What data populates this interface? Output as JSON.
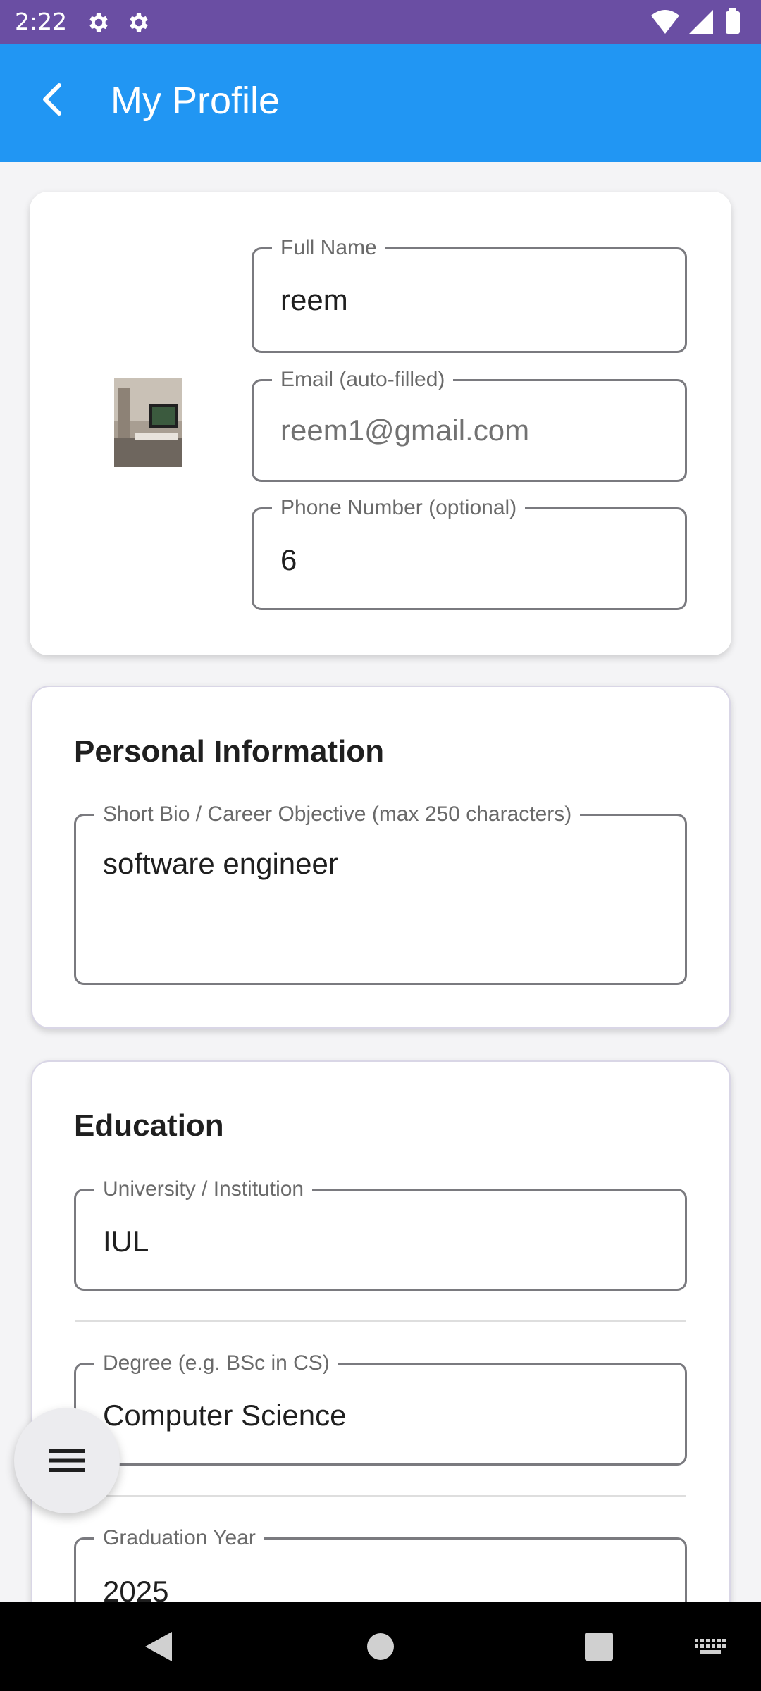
{
  "status_bar": {
    "time": "2:22",
    "icons": [
      "settings-icon",
      "settings-icon",
      "wifi-icon",
      "signal-icon",
      "battery-icon"
    ]
  },
  "app_bar": {
    "title": "My Profile",
    "back_icon": "chevron-left-icon"
  },
  "profile_card": {
    "avatar": "profile-photo",
    "full_name": {
      "label": "Full Name",
      "value": "reem"
    },
    "email": {
      "label": "Email (auto-filled)",
      "value": "reem1@gmail.com"
    },
    "phone": {
      "label": "Phone Number (optional)",
      "value": "6"
    }
  },
  "personal_info": {
    "title": "Personal Information",
    "bio": {
      "label": "Short Bio / Career Objective (max 250 characters)",
      "value": "software engineer"
    }
  },
  "education": {
    "title": "Education",
    "university": {
      "label": "University / Institution",
      "value": "IUL"
    },
    "degree": {
      "label": "Degree (e.g. BSc in CS)",
      "value": "Computer Science"
    },
    "graduation_year": {
      "label": "Graduation Year",
      "value": "2025"
    }
  },
  "fab": {
    "icon": "menu-icon"
  },
  "nav_bar": {
    "icons": [
      "back-triangle-icon",
      "home-circle-icon",
      "recents-square-icon",
      "keyboard-icon"
    ]
  },
  "colors": {
    "status_bar": "#6a4ea3",
    "app_bar": "#2196f3",
    "background": "#f4f4f6",
    "card": "#ffffff",
    "field_border": "#7a7a7f"
  }
}
